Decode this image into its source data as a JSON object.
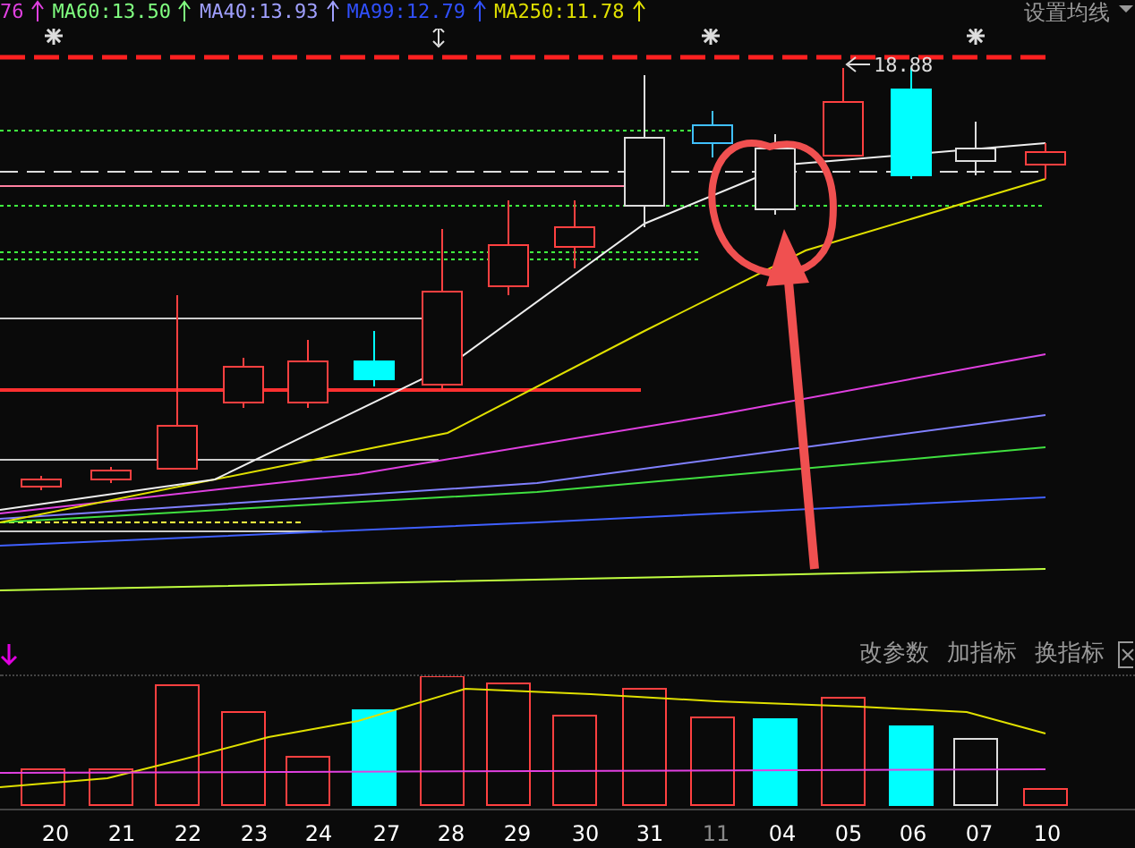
{
  "ma_legend": [
    {
      "text": "76",
      "color": "#e040e0"
    },
    {
      "text": "MA60:13.50",
      "color": "#80ff80"
    },
    {
      "text": "MA40:13.93",
      "color": "#a0a0ff"
    },
    {
      "text": "MA99:12.79",
      "color": "#3050ff"
    },
    {
      "text": "MA250:11.78",
      "color": "#e0e000"
    }
  ],
  "ma_settings": {
    "label": "设置均线"
  },
  "price_label": "18.88",
  "indicator_toolbar": {
    "buttons": [
      "改参数",
      "加指标",
      "换指标"
    ]
  },
  "date_axis": [
    {
      "label": "20",
      "kind": "day"
    },
    {
      "label": "21",
      "kind": "day"
    },
    {
      "label": "22",
      "kind": "day"
    },
    {
      "label": "23",
      "kind": "day"
    },
    {
      "label": "24",
      "kind": "day"
    },
    {
      "label": "27",
      "kind": "day"
    },
    {
      "label": "28",
      "kind": "day"
    },
    {
      "label": "29",
      "kind": "day"
    },
    {
      "label": "30",
      "kind": "day"
    },
    {
      "label": "31",
      "kind": "day"
    },
    {
      "label": "11",
      "kind": "month"
    },
    {
      "label": "04",
      "kind": "day"
    },
    {
      "label": "05",
      "kind": "day"
    },
    {
      "label": "06",
      "kind": "day"
    },
    {
      "label": "07",
      "kind": "day"
    },
    {
      "label": "10",
      "kind": "day"
    }
  ]
}
